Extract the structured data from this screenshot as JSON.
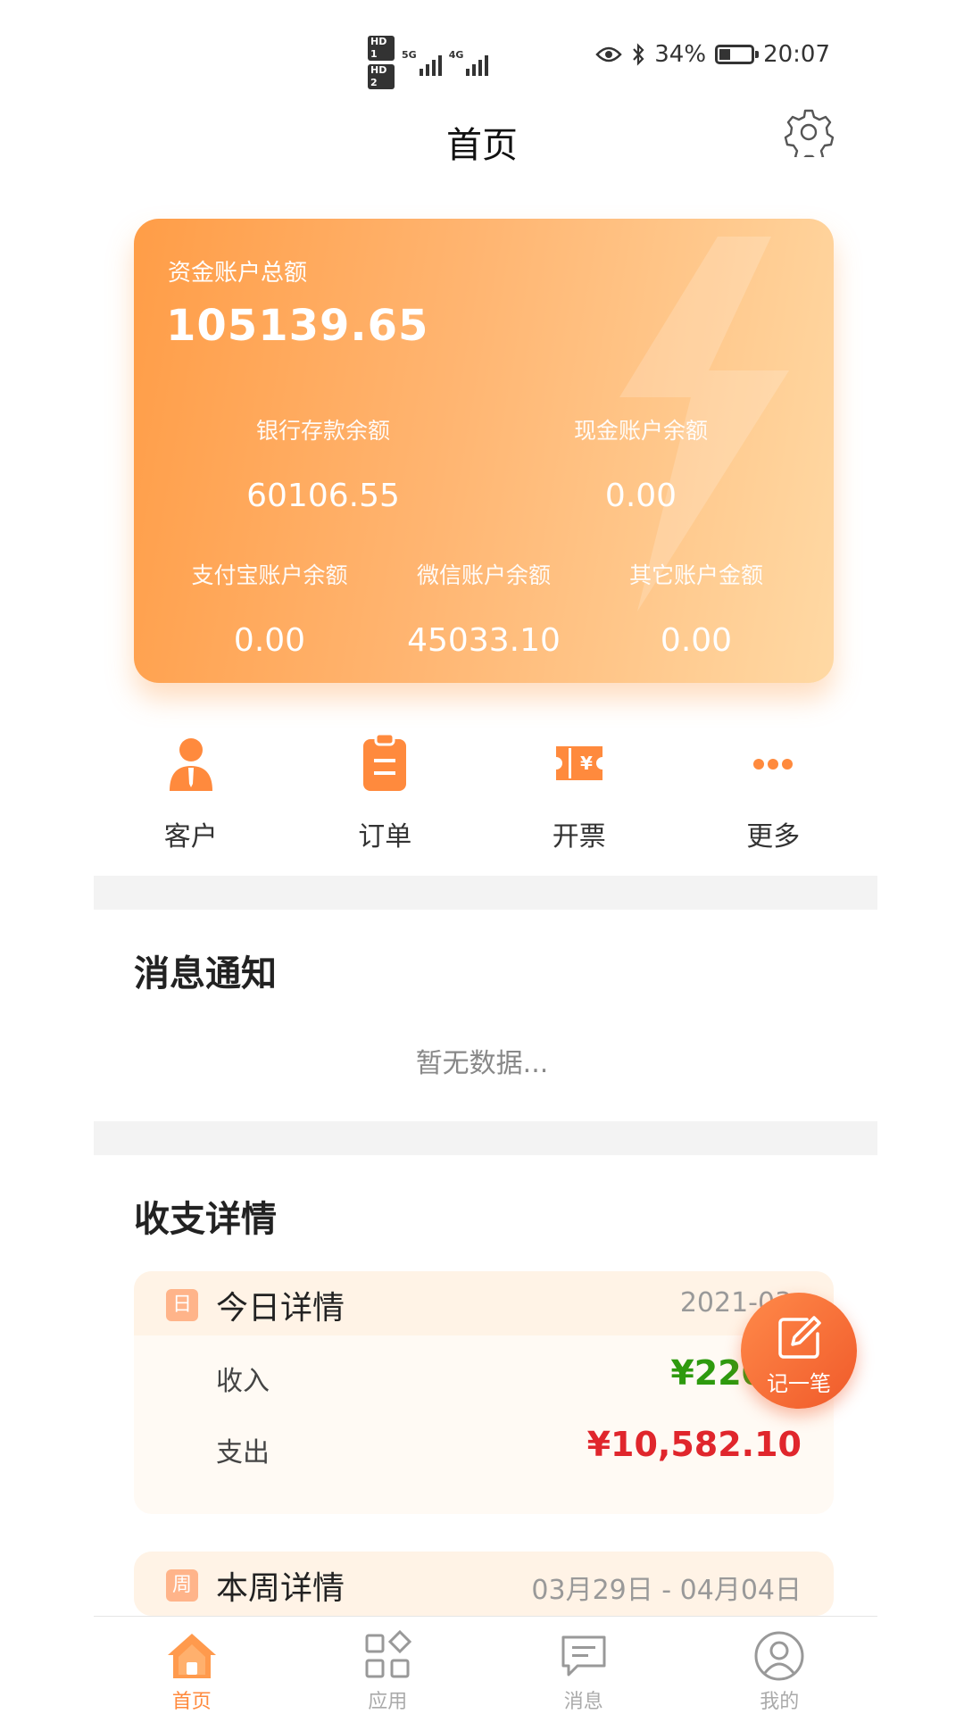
{
  "status_bar": {
    "hd1": "HD 1",
    "hd2": "HD 2",
    "net1": "5G",
    "net2": "4G",
    "battery": "34%",
    "time": "20:07",
    "battery_level": 0.34
  },
  "header": {
    "title": "首页",
    "settings_icon": "gear-icon"
  },
  "balance_card": {
    "total_label": "资金账户总额",
    "total_value": "105139.65",
    "bank_label": "银行存款余额",
    "bank_value": "60106.55",
    "cash_label": "现金账户余额",
    "cash_value": "0.00",
    "alipay_label": "支付宝账户余额",
    "alipay_value": "0.00",
    "wechat_label": "微信账户余额",
    "wechat_value": "45033.10",
    "other_label": "其它账户金额",
    "other_value": "0.00"
  },
  "quick_actions": [
    {
      "label": "客户",
      "icon": "customer-icon"
    },
    {
      "label": "订单",
      "icon": "clipboard-icon"
    },
    {
      "label": "开票",
      "icon": "ticket-icon"
    },
    {
      "label": "更多",
      "icon": "more-dots-icon"
    }
  ],
  "notifications": {
    "title": "消息通知",
    "empty_text": "暂无数据..."
  },
  "income": {
    "title": "收支详情",
    "today": {
      "badge": "日",
      "title": "今日详情",
      "date": "2021-03-",
      "income_label": "收入",
      "income_value": "¥220.0",
      "expense_label": "支出",
      "expense_value": "¥10,582.10"
    },
    "week": {
      "badge": "周",
      "title": "本周详情",
      "date": "03月29日 - 04月04日"
    }
  },
  "fab": {
    "label": "记一笔",
    "icon": "edit-icon"
  },
  "bottom_nav": [
    {
      "label": "首页",
      "icon": "home-icon",
      "active": true
    },
    {
      "label": "应用",
      "icon": "apps-grid-icon",
      "active": false
    },
    {
      "label": "消息",
      "icon": "message-icon",
      "active": false
    },
    {
      "label": "我的",
      "icon": "profile-icon",
      "active": false
    }
  ],
  "colors": {
    "accent": "#ff8a3d",
    "income_green": "#2e9a0e",
    "expense_red": "#e0262c",
    "card_start": "#ff9d47",
    "card_end": "#ffd9a4"
  }
}
